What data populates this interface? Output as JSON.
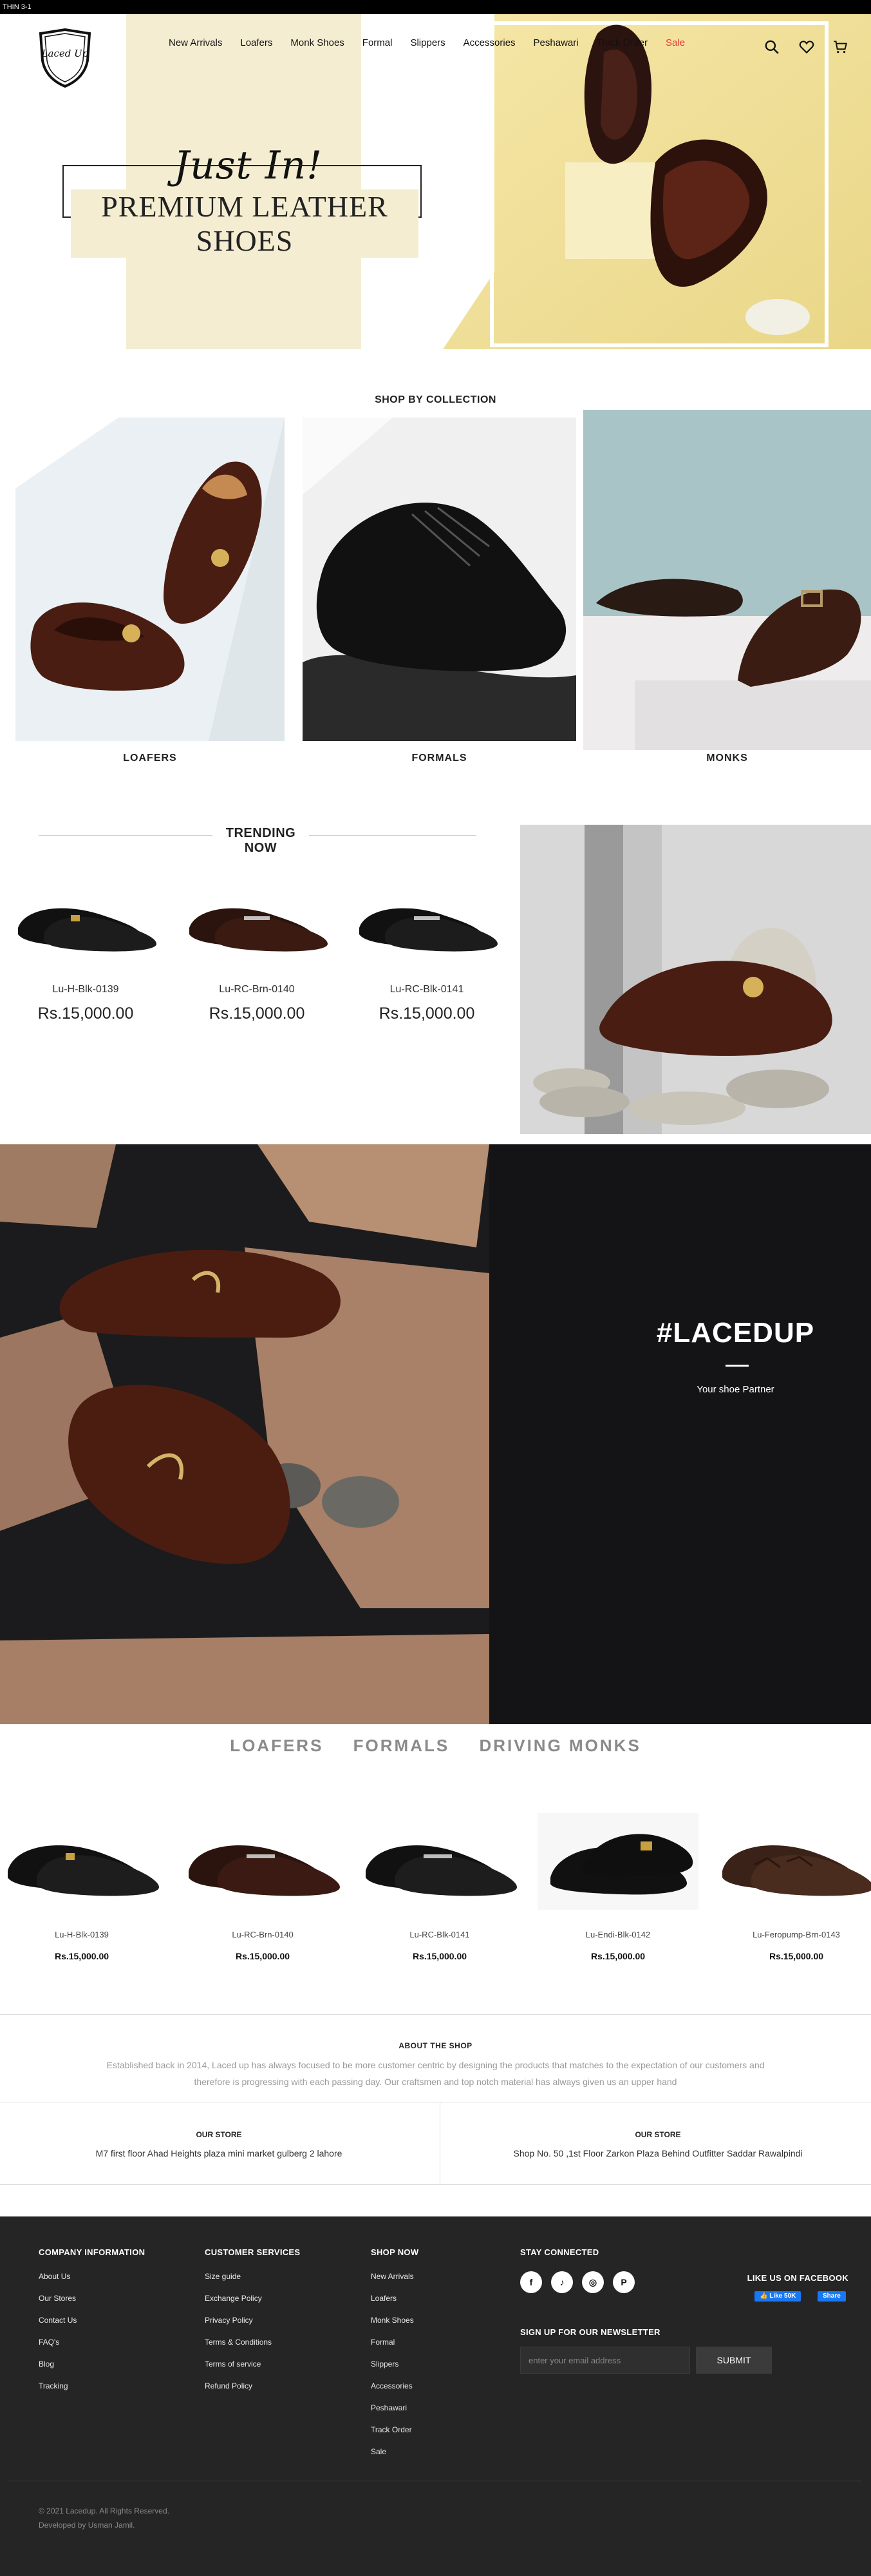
{
  "announcement": "THIN 3-1",
  "brand": {
    "logo_text": "Laced Up"
  },
  "nav": {
    "items": [
      "New Arrivals",
      "Loafers",
      "Monk Shoes",
      "Formal",
      "Slippers",
      "Accessories",
      "Peshawari",
      "Track Order",
      "Sale"
    ]
  },
  "header_icons": [
    "search-icon",
    "heart-icon",
    "cart-icon"
  ],
  "hero": {
    "line1": "Just In!",
    "line2": "PREMIUM LEATHER SHOES"
  },
  "collection": {
    "heading": "SHOP BY COLLECTION",
    "items": [
      {
        "label": "LOAFERS"
      },
      {
        "label": "FORMALS"
      },
      {
        "label": "MONKS"
      }
    ]
  },
  "trending": {
    "heading": "TRENDING NOW",
    "products": [
      {
        "name": "Lu-H-Blk-0139",
        "price": "Rs.15,000.00"
      },
      {
        "name": "Lu-RC-Brn-0140",
        "price": "Rs.15,000.00"
      },
      {
        "name": "Lu-RC-Blk-0141",
        "price": "Rs.15,000.00"
      }
    ]
  },
  "banner": {
    "title": "#LACEDUP",
    "subtitle": "Your shoe Partner"
  },
  "tabs": [
    "LOAFERS",
    "FORMALS",
    "DRIVING MONKS"
  ],
  "products": [
    {
      "name": "Lu-H-Blk-0139",
      "price": "Rs.15,000.00"
    },
    {
      "name": "Lu-RC-Brn-0140",
      "price": "Rs.15,000.00"
    },
    {
      "name": "Lu-RC-Blk-0141",
      "price": "Rs.15,000.00"
    },
    {
      "name": "Lu-Endi-Blk-0142",
      "price": "Rs.15,000.00"
    },
    {
      "name": "Lu-Feropump-Brn-0143",
      "price": "Rs.15,000.00"
    }
  ],
  "about": {
    "heading": "ABOUT THE SHOP",
    "text": "Established back in 2014, Laced up has always focused to be more customer centric by designing the products that matches to the expectation of our customers and therefore is progressing with each passing day. Our craftsmen and top notch material has always given us an upper hand"
  },
  "stores": [
    {
      "heading": "OUR STORE",
      "address": "M7 first floor Ahad Heights plaza mini market gulberg 2 lahore"
    },
    {
      "heading": "OUR STORE",
      "address": "Shop No. 50 ,1st Floor Zarkon Plaza Behind Outfitter Saddar Rawalpindi"
    }
  ],
  "footer": {
    "company": {
      "heading": "COMPANY INFORMATION",
      "links": [
        "About Us",
        "Our Stores",
        "Contact Us",
        "FAQ's",
        "Blog",
        "Tracking"
      ]
    },
    "services": {
      "heading": "CUSTOMER SERVICES",
      "links": [
        "Size guide",
        "Exchange Policy",
        "Privacy Policy",
        "Terms & Conditions",
        "Terms of service",
        "Refund Policy"
      ]
    },
    "shop": {
      "heading": "SHOP NOW",
      "links": [
        "New Arrivals",
        "Loafers",
        "Monk Shoes",
        "Formal",
        "Slippers",
        "Accessories",
        "Peshawari",
        "Track Order",
        "Sale"
      ]
    },
    "connect": {
      "heading": "STAY CONNECTED",
      "icons": [
        "facebook-icon",
        "tiktok-icon",
        "instagram-icon",
        "pinterest-icon"
      ],
      "glyphs": [
        "f",
        "♪",
        "◎",
        "P"
      ]
    },
    "newsletter": {
      "heading": "SIGN UP FOR OUR NEWSLETTER",
      "placeholder": "enter your email address",
      "button": "SUBMIT"
    },
    "facebook": {
      "heading": "LIKE US ON FACEBOOK",
      "like": "👍 Like 50K",
      "share": "Share"
    },
    "copyright": "© 2021 Lacedup. All Rights Reserved.",
    "developer": "Developed by Usman Jamil."
  },
  "colors": {
    "sale": "#e53935",
    "footer_bg": "#252525",
    "hero_beige": "#f4edd2",
    "facebook": "#1877f2"
  }
}
